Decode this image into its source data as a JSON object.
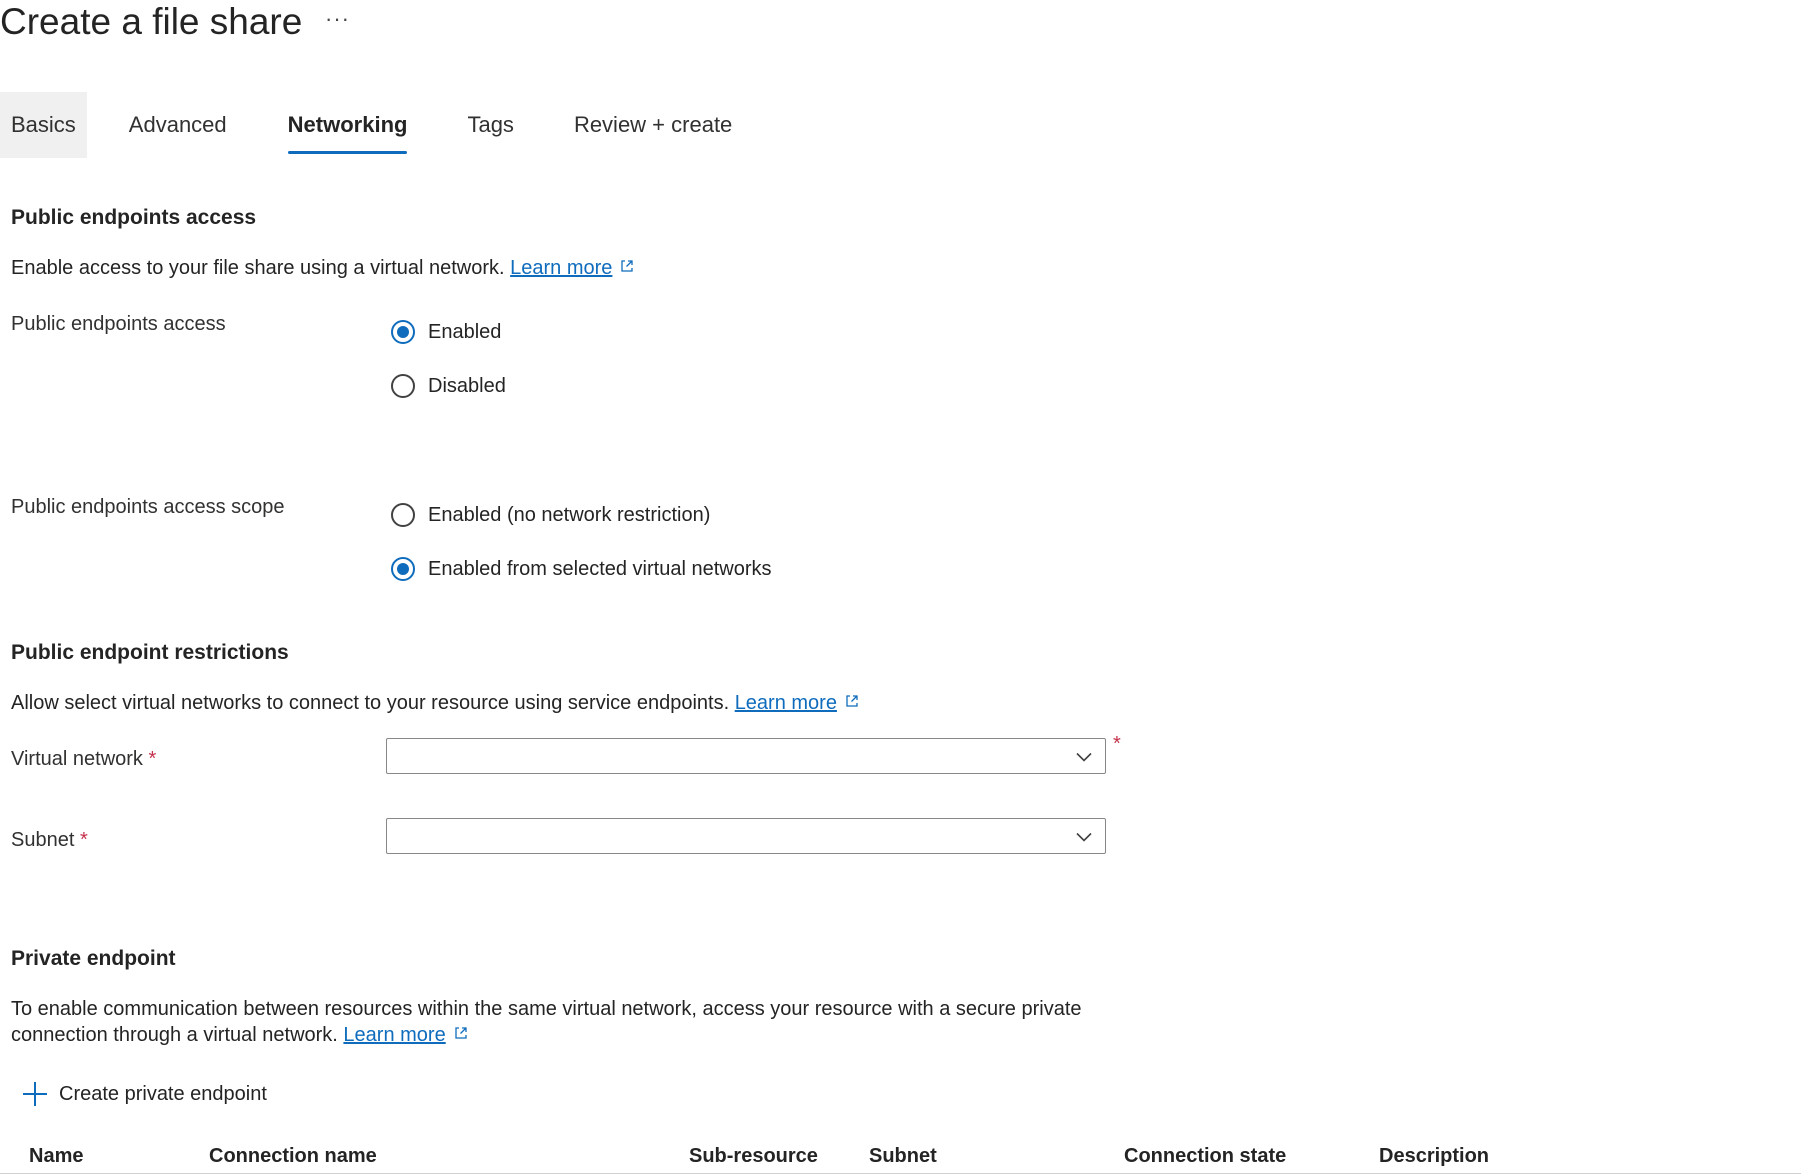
{
  "page": {
    "title": "Create a file share",
    "more_label": "···"
  },
  "tabs": [
    {
      "label": "Basics"
    },
    {
      "label": "Advanced"
    },
    {
      "label": "Networking",
      "active": true
    },
    {
      "label": "Tags"
    },
    {
      "label": "Review + create"
    }
  ],
  "public_access": {
    "heading": "Public endpoints access",
    "description": "Enable access to your file share using a virtual network.",
    "learn_more": "Learn more",
    "field_label": "Public endpoints access",
    "options": [
      {
        "label": "Enabled",
        "selected": true
      },
      {
        "label": "Disabled",
        "selected": false
      }
    ],
    "scope_label": "Public endpoints access scope",
    "scope_options": [
      {
        "label": "Enabled (no network restriction)",
        "selected": false
      },
      {
        "label": "Enabled from selected virtual networks",
        "selected": true
      }
    ]
  },
  "restrictions": {
    "heading": "Public endpoint restrictions",
    "description": "Allow select virtual networks to connect to your resource using service endpoints.",
    "learn_more": "Learn more",
    "virtual_network_label": "Virtual network",
    "virtual_network_value": "",
    "subnet_label": "Subnet",
    "subnet_value": "",
    "required_mark": "*"
  },
  "private_endpoint": {
    "heading": "Private endpoint",
    "description_line1": "To enable communication between resources within the same virtual network, access your resource with a secure private",
    "description_line2": "connection through a virtual network.",
    "learn_more": "Learn more",
    "create_label": "Create private endpoint",
    "columns": [
      "Name",
      "Connection name",
      "Sub-resource",
      "Subnet",
      "Connection state",
      "Description"
    ]
  },
  "colors": {
    "accent": "#0f6cbd",
    "required": "#c4314b",
    "text": "#242424"
  }
}
